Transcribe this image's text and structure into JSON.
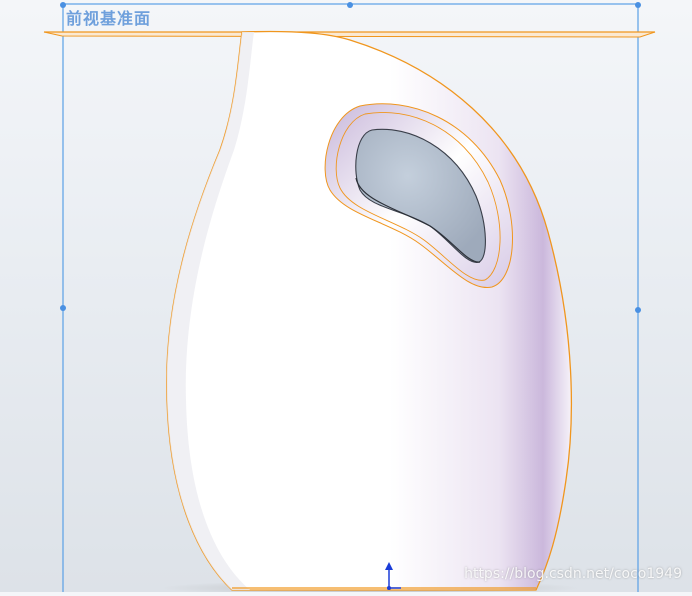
{
  "viewport": {
    "plane_label": "前视基准面",
    "watermark": "https://blog.csdn.net/coco1949"
  },
  "colors": {
    "plane_outline": "#5aa0e6",
    "edge_highlight": "#f0961e",
    "body_shadow": "#d8c8e8",
    "triad_z": "#1a3cd8"
  },
  "icons": {
    "handle": "handle-anchor-icon",
    "triad": "axis-triad-icon"
  }
}
